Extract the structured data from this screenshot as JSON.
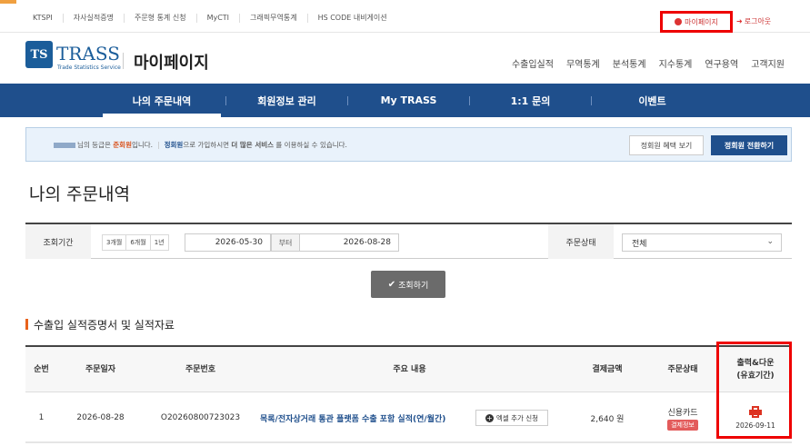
{
  "topbar": {
    "links": [
      "KTSPI",
      "자사실적증명",
      "주문형 통계 신청",
      "MyCTI",
      "그래픽무역통계",
      "HS CODE 내비게이션"
    ],
    "mypage": "마이페이지",
    "logout": "로그아웃"
  },
  "header": {
    "logo_ts": "TS",
    "logo_text": "TRASS",
    "logo_sub": "Trade Statistics Service",
    "page_title": "마이페이지",
    "menu": [
      "수출입실적",
      "무역통계",
      "분석통계",
      "지수통계",
      "연구용역",
      "고객지원"
    ]
  },
  "subnav": {
    "items": [
      "나의 주문내역",
      "회원정보 관리",
      "My TRASS",
      "1:1 문의",
      "이벤트"
    ],
    "active_index": 0
  },
  "notice": {
    "part1": "님의 등급은 ",
    "grade": "준회원",
    "part2": "입니다.",
    "part3_label": "정회원",
    "part3": "으로 가입하시면 ",
    "more": "더 많은 서비스",
    "part4": " 를 이용하실 수 있습니다.",
    "benefit_btn": "정회원 혜택 보기",
    "convert_btn": "정회원 전환하기"
  },
  "section_title": "나의 주문내역",
  "filter": {
    "period_label": "조회기간",
    "period_buttons": [
      "3개월",
      "6개월",
      "1년"
    ],
    "date_from": "2026-05-30",
    "between": "부터",
    "date_to": "2026-08-28",
    "status_label": "주문상태",
    "status_value": "전체",
    "search_btn": "조회하기"
  },
  "list": {
    "title": "수출입 실적증명서 및 실적자료",
    "headers": {
      "no": "순번",
      "date": "주문일자",
      "order_no": "주문번호",
      "content": "주요 내용",
      "amount": "결제금액",
      "status": "주문상태",
      "print": "출력&다운",
      "print2": "(유효기간)"
    },
    "rows": [
      {
        "no": "1",
        "date": "2026-08-28",
        "order_no": "O20260800723023",
        "content": "목록/전자상거래 통관 플랫폼 수출 포함 실적(연/월간)",
        "excel_btn": "엑셀 추가 신청",
        "amount": "2,640 원",
        "pay_method": "신용카드",
        "pay_badge": "결제정보",
        "valid_until": "2026-09-11"
      }
    ]
  },
  "colors": {
    "brand": "#1f4f8c",
    "accent_red": "#e00000",
    "badge_red": "#e35b5b",
    "orange_marker": "#e8621c"
  }
}
